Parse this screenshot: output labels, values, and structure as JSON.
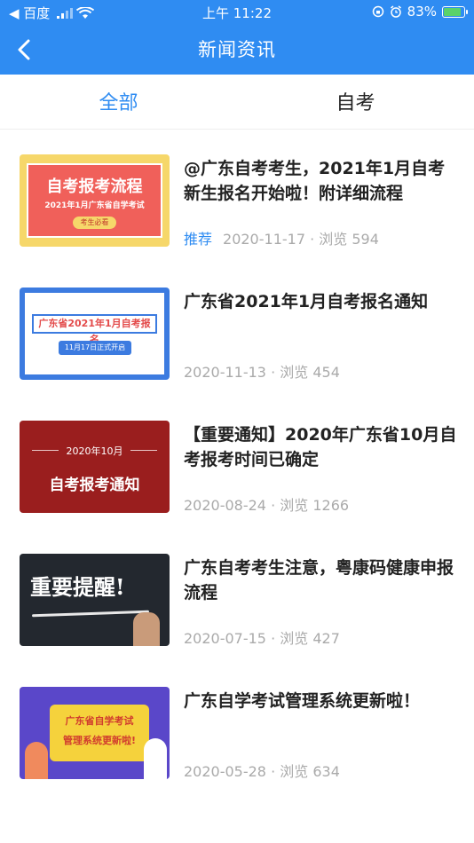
{
  "status_bar": {
    "carrier": "◀ 百度",
    "time": "上午 11:22",
    "battery": "83%"
  },
  "nav": {
    "title": "新闻资讯"
  },
  "tabs": [
    {
      "label": "全部"
    },
    {
      "label": "自考"
    }
  ],
  "news": [
    {
      "title": "@广东自考考生，2021年1月自考新生报名开始啦！附详细流程",
      "tag": "推荐",
      "date": "2020-11-17",
      "views": "· 浏览 594",
      "thumb_title": "自考报考流程",
      "thumb_sub": "2021年1月广东省自学考试",
      "thumb_badge": "考生必看"
    },
    {
      "title": "广东省2021年1月自考报名通知",
      "tag": "",
      "date": "2020-11-13",
      "views": "· 浏览 454",
      "thumb_title": "广东省2021年1月自考报名",
      "thumb_sub": "11月17日正式开启"
    },
    {
      "title": "【重要通知】2020年广东省10月自考报考时间已确定",
      "tag": "",
      "date": "2020-08-24",
      "views": "· 浏览 1266",
      "thumb_title": "自考报考通知",
      "thumb_sub": "2020年10月"
    },
    {
      "title": "广东自考考生注意，粤康码健康申报流程",
      "tag": "",
      "date": "2020-07-15",
      "views": "· 浏览 427",
      "thumb_title": "重要提醒!"
    },
    {
      "title": "广东自学考试管理系统更新啦！",
      "tag": "",
      "date": "2020-05-28",
      "views": "· 浏览 634",
      "thumb_title": "广东省自学考试",
      "thumb_sub": "管理系统更新啦!"
    }
  ]
}
